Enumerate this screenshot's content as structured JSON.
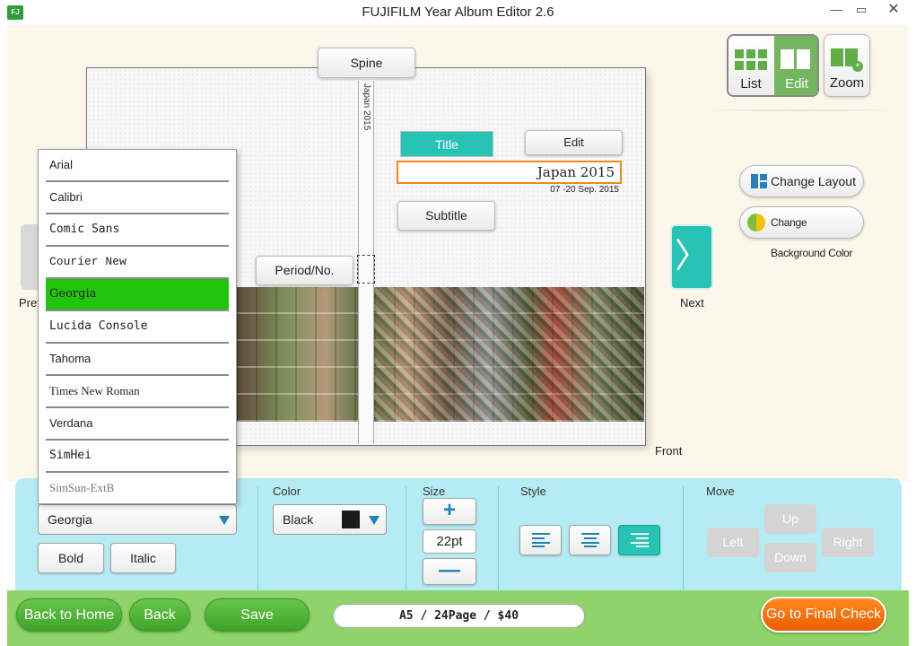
{
  "window": {
    "title": "FUJIFILM Year Album Editor 2.6",
    "icon_name": "fujifilm-app-icon",
    "minimize_glyph": "—",
    "maximize_glyph": "▭",
    "close_glyph": "✕"
  },
  "canvas": {
    "spine_label": "Spine",
    "spine_text": "Japan 2015",
    "title_label": "Title",
    "edit_label": "Edit",
    "title_value": "Japan 2015",
    "date_text": "07 -20 Sep. 2015",
    "subtitle_label": "Subtitle",
    "period_label": "Period/No.",
    "front_label": "Front"
  },
  "view_modes": {
    "list_label": "List",
    "edit_label": "Edit",
    "zoom_label": "Zoom",
    "active": "Edit"
  },
  "side_actions": {
    "change_layout": "Change Layout",
    "change_background": "Change Background Color"
  },
  "navigation": {
    "next_label": "Next",
    "next_glyph": "〉",
    "prev_label": "Prev"
  },
  "font_dropdown": {
    "options": [
      "Arial",
      "Calibri",
      "Comic Sans",
      "Courier New",
      "Georgia",
      "Lucida Console",
      "Tahoma",
      "Times New Roman",
      "Verdana",
      "SimHei",
      "SimSun-ExtB"
    ],
    "selected": "Georgia"
  },
  "panel": {
    "font_value": "Georgia",
    "bold_label": "Bold",
    "italic_label": "Italic",
    "color_heading": "Color",
    "color_value": "Black",
    "color_swatch": "#1a1a1a",
    "size_heading": "Size",
    "size_plus": "+",
    "size_value": "22pt",
    "size_minus": "—",
    "style_heading": "Style",
    "alignment_active": "right",
    "move_heading": "Move",
    "move_up": "Up",
    "move_left": "Left",
    "move_right": "Right",
    "move_down": "Down"
  },
  "footer": {
    "back_to_home": "Back to Home",
    "back": "Back",
    "save": "Save",
    "album_info": "A5 / 24Page / $40",
    "final_check": "Go to Final Check"
  },
  "colors": {
    "accent_teal": "#27c4b5",
    "highlight_orange": "#f08a20",
    "selected_green": "#22c410",
    "panel_blue": "#b5ecf3",
    "footer_green": "#8fd46a"
  }
}
